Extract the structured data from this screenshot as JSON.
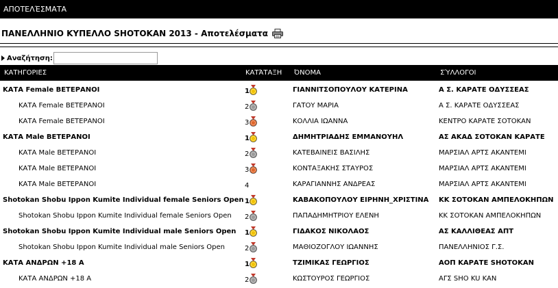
{
  "topbar": {
    "title": "ΑΠΟΤΕΛΈΣΜΑΤΑ"
  },
  "page": {
    "title": "ΠΑΝΕΛΛΗΝΙΟ ΚΥΠΕΛΛΟ SHOTOKAN 2013 - Αποτελέσματα",
    "print_icon": "printer-icon"
  },
  "search": {
    "label": "Αναζήτηση:",
    "value": ""
  },
  "table": {
    "headers": {
      "category": "ΚΑΤΗΓΟΡΙΕΣ",
      "rank": "ΚΑΤΆΤΑΞΗ",
      "name": "ΌΝΟΜΑ",
      "club": "ΣΎΛΛΟΓΟΙ"
    },
    "medal_colors": {
      "gold": "#f2c200",
      "silver": "#9a9a9a",
      "bronze": "#e0662a"
    },
    "rows": [
      {
        "category": "ΚΑΤΑ Female ΒΕΤΕΡΑΝΟΙ",
        "rank": "1",
        "medal": "gold",
        "name": "ΓΙΑΝΝΙΤΣΟΠΟΥΛΟΥ ΚΑΤΕΡΙΝΑ",
        "club": "Α Σ. ΚΑΡΑΤΕ ΟΔΥΣΣΕΑΣ",
        "main": true
      },
      {
        "category": "ΚΑΤΑ Female ΒΕΤΕΡΑΝΟΙ",
        "rank": "2",
        "medal": "silver",
        "name": "ΓΑΤΟΥ ΜΑΡΙΑ",
        "club": "Α Σ. ΚΑΡΑΤΕ ΟΔΥΣΣΕΑΣ",
        "main": false
      },
      {
        "category": "ΚΑΤΑ Female ΒΕΤΕΡΑΝΟΙ",
        "rank": "3",
        "medal": "bronze",
        "name": "ΚΟΛΛΙΑ ΙΩΑΝΝΑ",
        "club": "ΚΕΝΤΡΟ ΚΑΡΑΤΕ ΣΟΤΟΚΑΝ",
        "main": false
      },
      {
        "category": "ΚΑΤΑ Male ΒΕΤΕΡΑΝΟΙ",
        "rank": "1",
        "medal": "gold",
        "name": "ΔΗΜΗΤΡΙΑΔΗΣ ΕΜΜΑΝΟΥΗΛ",
        "club": "ΑΣ ΑΚΑΔ ΣΟΤΟΚΑΝ ΚΑΡΑΤΕ",
        "main": true
      },
      {
        "category": "ΚΑΤΑ Male ΒΕΤΕΡΑΝΟΙ",
        "rank": "2",
        "medal": "silver",
        "name": "ΚΑΤΕΒΑΙΝΕΙΣ ΒΑΣΙΛΗΣ",
        "club": "ΜΑΡΣΙΑΛ ΑΡΤΣ ΑΚΑΝΤΕΜΙ",
        "main": false
      },
      {
        "category": "ΚΑΤΑ Male ΒΕΤΕΡΑΝΟΙ",
        "rank": "3",
        "medal": "bronze",
        "name": "ΚΟΝΤΑΞΑΚΗΣ ΣΤΑΥΡΟΣ",
        "club": "ΜΑΡΣΙΑΛ ΑΡΤΣ ΑΚΑΝΤΕΜΙ",
        "main": false
      },
      {
        "category": "ΚΑΤΑ Male ΒΕΤΕΡΑΝΟΙ",
        "rank": "4",
        "medal": "",
        "name": "ΚΑΡΑΓΙΑΝΝΗΣ ΑΝΔΡΕΑΣ",
        "club": "ΜΑΡΣΙΑΛ ΑΡΤΣ ΑΚΑΝΤΕΜΙ",
        "main": false
      },
      {
        "category": "Shotokan Shobu Ippon Kumite Individual female Seniors Open",
        "rank": "1",
        "medal": "gold",
        "name": "ΚΑΒΑΚΟΠΟΥΛΟΥ ΕΙΡΗΝΗ_ΧΡΙΣΤΙΝΑ",
        "club": "ΚΚ ΣΟΤΟΚΑΝ ΑΜΠΕΛΟΚΗΠΩΝ",
        "main": true
      },
      {
        "category": "Shotokan Shobu Ippon Kumite Individual female Seniors Open",
        "rank": "2",
        "medal": "silver",
        "name": "ΠΑΠΑΔΗΜΗΤΡΙΟΥ ΕΛΕΝΗ",
        "club": "ΚΚ ΣΟΤΟΚΑΝ ΑΜΠΕΛΟΚΗΠΩΝ",
        "main": false
      },
      {
        "category": "Shotokan Shobu Ippon Kumite Individual male Seniors Open",
        "rank": "1",
        "medal": "gold",
        "name": "ΓΙΔΑΚΟΣ ΝΙΚΟΛΑΟΣ",
        "club": "ΑΣ ΚΑΛΛΙΘΕΑΣ ΑΠΤ",
        "main": true
      },
      {
        "category": "Shotokan Shobu Ippon Kumite Individual male Seniors Open",
        "rank": "2",
        "medal": "silver",
        "name": "ΜΑΘΙΟΖΟΓΛΟΥ ΙΩΑΝΝΗΣ",
        "club": "ΠΑΝΕΛΛΗΝΙΟΣ Γ.Σ.",
        "main": false
      },
      {
        "category": "ΚΑΤΑ ΑΝΔΡΩΝ +18 Α",
        "rank": "1",
        "medal": "gold",
        "name": "ΤΖΙΜΙΚΑΣ ΓΕΩΡΓΙΟΣ",
        "club": "ΑΟΠ ΚΑΡΑΤΕ SHOTOKAN",
        "main": true
      },
      {
        "category": "ΚΑΤΑ ΑΝΔΡΩΝ +18 Α",
        "rank": "2",
        "medal": "silver",
        "name": "ΚΩΣΤΟΥΡΟΣ ΓΕΩΡΓΙΟΣ",
        "club": "ΑΓΣ SHO KU KAN",
        "main": false
      }
    ]
  }
}
